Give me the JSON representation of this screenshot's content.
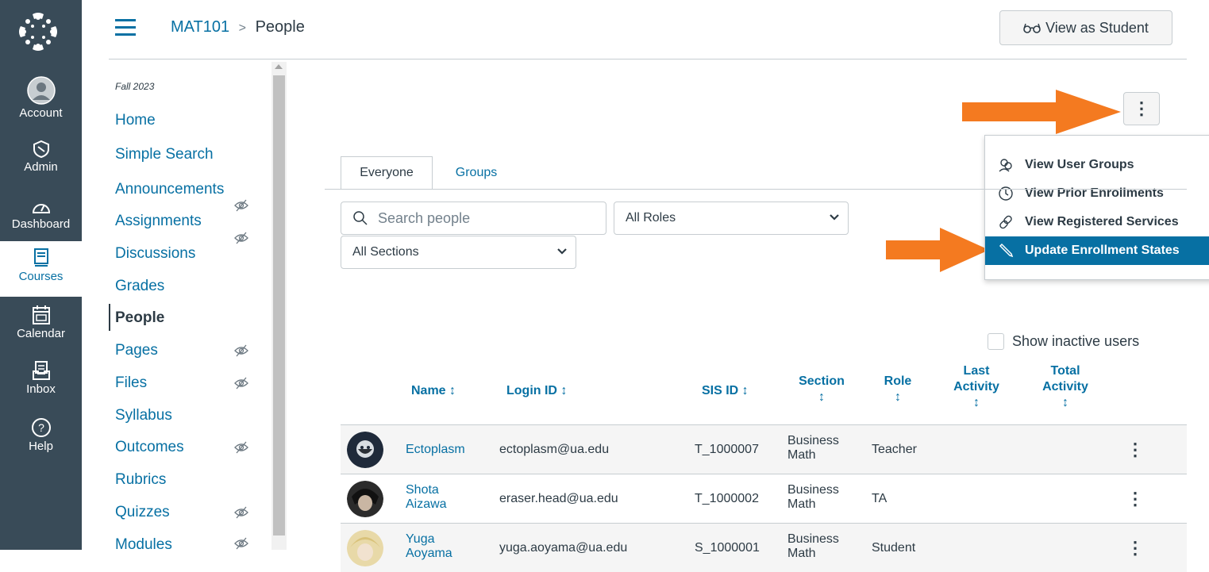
{
  "global_nav": {
    "items": [
      {
        "label": "Account",
        "icon": "account-icon"
      },
      {
        "label": "Admin",
        "icon": "admin-icon"
      },
      {
        "label": "Dashboard",
        "icon": "dashboard-icon"
      },
      {
        "label": "Courses",
        "icon": "courses-icon"
      },
      {
        "label": "Calendar",
        "icon": "calendar-icon"
      },
      {
        "label": "Inbox",
        "icon": "inbox-icon"
      },
      {
        "label": "Help",
        "icon": "help-icon"
      }
    ]
  },
  "header": {
    "course": "MAT101",
    "separator": ">",
    "current": "People",
    "view_student_icon": "glasses-icon",
    "view_student": "View as Student"
  },
  "course_nav": {
    "term": "Fall 2023",
    "items": [
      {
        "label": "Home",
        "hidden": false
      },
      {
        "label": "Simple Search",
        "hidden": false
      },
      {
        "label": "Announcements",
        "hidden": true
      },
      {
        "label": "Assignments",
        "hidden": true
      },
      {
        "label": "Discussions",
        "hidden": false
      },
      {
        "label": "Grades",
        "hidden": false
      },
      {
        "label": "People",
        "hidden": false,
        "active": true
      },
      {
        "label": "Pages",
        "hidden": true
      },
      {
        "label": "Files",
        "hidden": true
      },
      {
        "label": "Syllabus",
        "hidden": false
      },
      {
        "label": "Outcomes",
        "hidden": true
      },
      {
        "label": "Rubrics",
        "hidden": false
      },
      {
        "label": "Quizzes",
        "hidden": true
      },
      {
        "label": "Modules",
        "hidden": true
      }
    ]
  },
  "options_menu": {
    "items": [
      {
        "label": "View User Groups",
        "icon": "groups-icon"
      },
      {
        "label": "View Prior Enrollments",
        "icon": "clock-icon"
      },
      {
        "label": "View Registered Services",
        "icon": "link-icon"
      },
      {
        "label": "Update Enrollment States",
        "icon": "pencil-icon",
        "selected": true
      }
    ]
  },
  "tabs": {
    "everyone": "Everyone",
    "groups": "Groups"
  },
  "filters": {
    "search_placeholder": "Search people",
    "roles": "All Roles",
    "sections": "All Sections"
  },
  "show_inactive": "Show inactive users",
  "table": {
    "headers": {
      "name": "Name ↕",
      "login": "Login ID ↕",
      "sis": "SIS ID ↕",
      "section1": "Section",
      "section2": "↕",
      "role1": "Role",
      "role2": "↕",
      "last1": "Last",
      "last2": "Activity",
      "last3": "↕",
      "total1": "Total",
      "total2": "Activity",
      "total3": "↕"
    },
    "rows": [
      {
        "name1": "Ectoplasm",
        "name2": "",
        "login": "ectoplasm@ua.edu",
        "sis": "T_1000007",
        "section1": "Business",
        "section2": "Math",
        "role": "Teacher"
      },
      {
        "name1": "Shota",
        "name2": "Aizawa",
        "login": "eraser.head@ua.edu",
        "sis": "T_1000002",
        "section1": "Business",
        "section2": "Math",
        "role": "TA"
      },
      {
        "name1": "Yuga",
        "name2": "Aoyama",
        "login": "yuga.aoyama@ua.edu",
        "sis": "S_1000001",
        "section1": "Business",
        "section2": "Math",
        "role": "Student"
      }
    ]
  },
  "colors": {
    "accent": "#0770a3",
    "nav_bg": "#394b58",
    "arrow": "#f47a20"
  }
}
